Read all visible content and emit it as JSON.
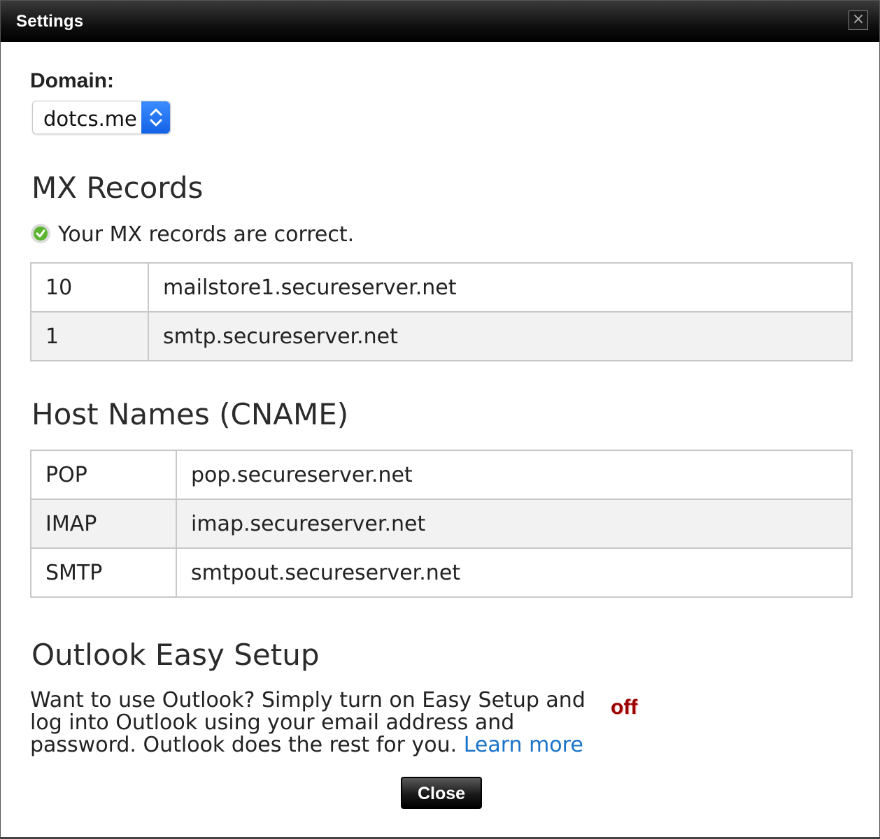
{
  "window": {
    "title": "Settings",
    "close_icon": "close-icon"
  },
  "domain": {
    "label": "Domain:",
    "selected": "dotcs.me"
  },
  "mx": {
    "heading": "MX Records",
    "status": "Your MX records are correct.",
    "status_icon": "check-circle-icon",
    "rows": [
      {
        "priority": "10",
        "host": "mailstore1.secureserver.net"
      },
      {
        "priority": "1",
        "host": "smtp.secureserver.net"
      }
    ]
  },
  "cname": {
    "heading": "Host Names (CNAME)",
    "rows": [
      {
        "name": "POP",
        "host": "pop.secureserver.net"
      },
      {
        "name": "IMAP",
        "host": "imap.secureserver.net"
      },
      {
        "name": "SMTP",
        "host": "smtpout.secureserver.net"
      }
    ]
  },
  "outlook": {
    "heading": "Outlook Easy Setup",
    "description": "Want to use Outlook? Simply turn on Easy Setup and log into Outlook using your email address and password. Outlook does the rest for you.",
    "learn_more": "Learn more",
    "toggle_state": "off"
  },
  "footer": {
    "close_label": "Close"
  },
  "colors": {
    "titlebar": "#000000",
    "link": "#1a73c9",
    "toggle_off": "#990000",
    "select_accent": "#1f6fee"
  }
}
